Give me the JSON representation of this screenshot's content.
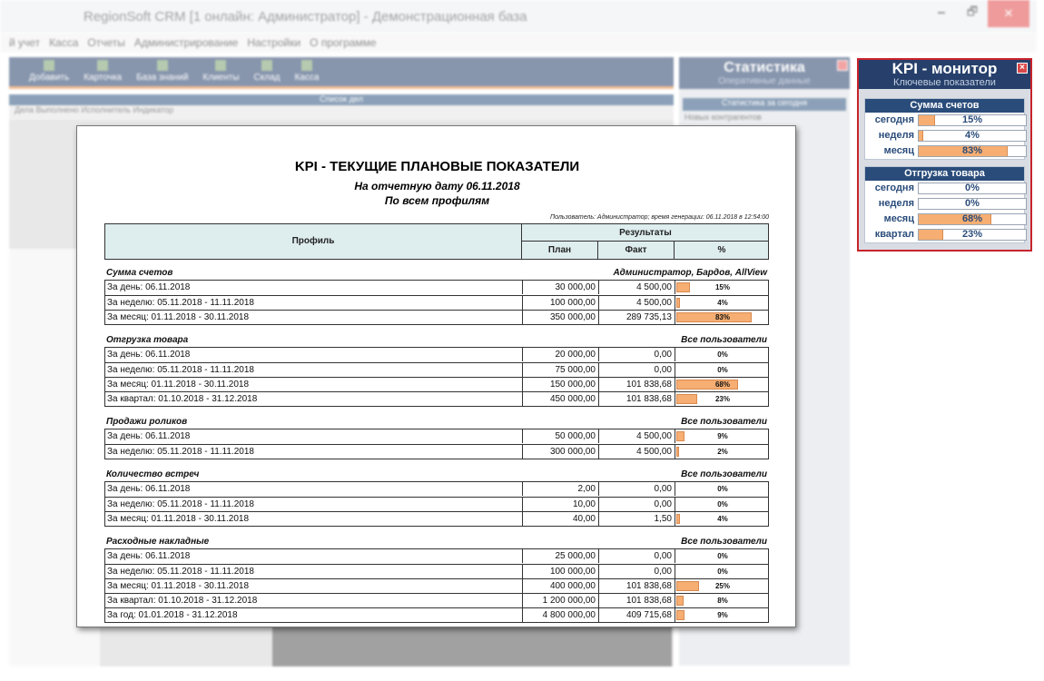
{
  "window": {
    "title": "RegionSoft CRM [1 онлайн: Администратор] - Демонстрационная база",
    "min": "🗕",
    "max": "🗗",
    "close": "✕"
  },
  "menu": [
    "й учет",
    "Касса",
    "Отчеты",
    "Администрирование",
    "Настройки",
    "О программе"
  ],
  "toolbar": [
    "Добавить",
    "Карточка",
    "База знаний",
    "Клиенты",
    "Склад",
    "Касса"
  ],
  "left_panel": {
    "header": "Список дел",
    "columns": "Дела   Выполнено   Исполнитель   Индикатор"
  },
  "stat_panel": {
    "title": "Статистика",
    "subtitle": "Оперативные данные",
    "bar": "Статистика за сегодня",
    "item": "Новых контрагентов"
  },
  "kpi_monitor": {
    "title": "KPI - монитор",
    "subtitle": "Ключевые показатели",
    "close": "×",
    "sections": [
      {
        "title": "Сумма счетов",
        "rows": [
          {
            "label": "сегодня",
            "value": "15%",
            "fraction": 0.15
          },
          {
            "label": "неделя",
            "value": "4%",
            "fraction": 0.04
          },
          {
            "label": "месяц",
            "value": "83%",
            "fraction": 0.83
          }
        ]
      },
      {
        "title": "Отгрузка товара",
        "rows": [
          {
            "label": "сегодня",
            "value": "0%",
            "fraction": 0
          },
          {
            "label": "неделя",
            "value": "0%",
            "fraction": 0
          },
          {
            "label": "месяц",
            "value": "68%",
            "fraction": 0.68
          },
          {
            "label": "квартал",
            "value": "23%",
            "fraction": 0.23
          }
        ]
      }
    ]
  },
  "report": {
    "title": "KPI - ТЕКУЩИЕ ПЛАНОВЫЕ ПОКАЗАТЕЛИ",
    "date_line": "На отчетную дату 06.11.2018",
    "profiles_line": "По всем профилям",
    "meta": "Пользователь: Администратор; время генерации: 06.11.2018 в 12:54:00",
    "header": {
      "profile": "Профиль",
      "results": "Результаты",
      "plan": "План",
      "fact": "Факт",
      "pct": "%"
    },
    "sections": [
      {
        "name": "Сумма счетов",
        "who": "Администратор, Бардов, AllView",
        "rows": [
          {
            "period": "За день: 06.11.2018",
            "plan": "30 000,00",
            "fact": "4 500,00",
            "pct": "15%",
            "fraction": 0.15
          },
          {
            "period": "За неделю: 05.11.2018 - 11.11.2018",
            "plan": "100 000,00",
            "fact": "4 500,00",
            "pct": "4%",
            "fraction": 0.04
          },
          {
            "period": "За месяц: 01.11.2018 - 30.11.2018",
            "plan": "350 000,00",
            "fact": "289 735,13",
            "pct": "83%",
            "fraction": 0.83
          }
        ]
      },
      {
        "name": "Отгрузка товара",
        "who": "Все пользователи",
        "rows": [
          {
            "period": "За день: 06.11.2018",
            "plan": "20 000,00",
            "fact": "0,00",
            "pct": "0%",
            "fraction": 0
          },
          {
            "period": "За неделю: 05.11.2018 - 11.11.2018",
            "plan": "75 000,00",
            "fact": "0,00",
            "pct": "0%",
            "fraction": 0
          },
          {
            "period": "За месяц: 01.11.2018 - 30.11.2018",
            "plan": "150 000,00",
            "fact": "101 838,68",
            "pct": "68%",
            "fraction": 0.68
          },
          {
            "period": "За квартал: 01.10.2018 - 31.12.2018",
            "plan": "450 000,00",
            "fact": "101 838,68",
            "pct": "23%",
            "fraction": 0.23
          }
        ]
      },
      {
        "name": "Продажи роликов",
        "who": "Все пользователи",
        "rows": [
          {
            "period": "За день: 06.11.2018",
            "plan": "50 000,00",
            "fact": "4 500,00",
            "pct": "9%",
            "fraction": 0.09
          },
          {
            "period": "За неделю: 05.11.2018 - 11.11.2018",
            "plan": "300 000,00",
            "fact": "4 500,00",
            "pct": "2%",
            "fraction": 0.02
          }
        ]
      },
      {
        "name": "Количество встреч",
        "who": "Все пользователи",
        "rows": [
          {
            "period": "За день: 06.11.2018",
            "plan": "2,00",
            "fact": "0,00",
            "pct": "0%",
            "fraction": 0
          },
          {
            "period": "За неделю: 05.11.2018 - 11.11.2018",
            "plan": "10,00",
            "fact": "0,00",
            "pct": "0%",
            "fraction": 0
          },
          {
            "period": "За месяц: 01.11.2018 - 30.11.2018",
            "plan": "40,00",
            "fact": "1,50",
            "pct": "4%",
            "fraction": 0.04
          }
        ]
      },
      {
        "name": "Расходные накладные",
        "who": "Все пользователи",
        "rows": [
          {
            "period": "За день: 06.11.2018",
            "plan": "25 000,00",
            "fact": "0,00",
            "pct": "0%",
            "fraction": 0
          },
          {
            "period": "За неделю: 05.11.2018 - 11.11.2018",
            "plan": "100 000,00",
            "fact": "0,00",
            "pct": "0%",
            "fraction": 0
          },
          {
            "period": "За месяц: 01.11.2018 - 30.11.2018",
            "plan": "400 000,00",
            "fact": "101 838,68",
            "pct": "25%",
            "fraction": 0.25
          },
          {
            "period": "За квартал: 01.10.2018 - 31.12.2018",
            "plan": "1 200 000,00",
            "fact": "101 838,68",
            "pct": "8%",
            "fraction": 0.08
          },
          {
            "period": "За год: 01.01.2018 - 31.12.2018",
            "plan": "4 800 000,00",
            "fact": "409 715,68",
            "pct": "9%",
            "fraction": 0.09
          }
        ]
      }
    ]
  },
  "colors": {
    "accent": "#f6ae72",
    "navy": "#26406b",
    "kpi_border": "#c8232c",
    "table_header": "#deedee"
  }
}
